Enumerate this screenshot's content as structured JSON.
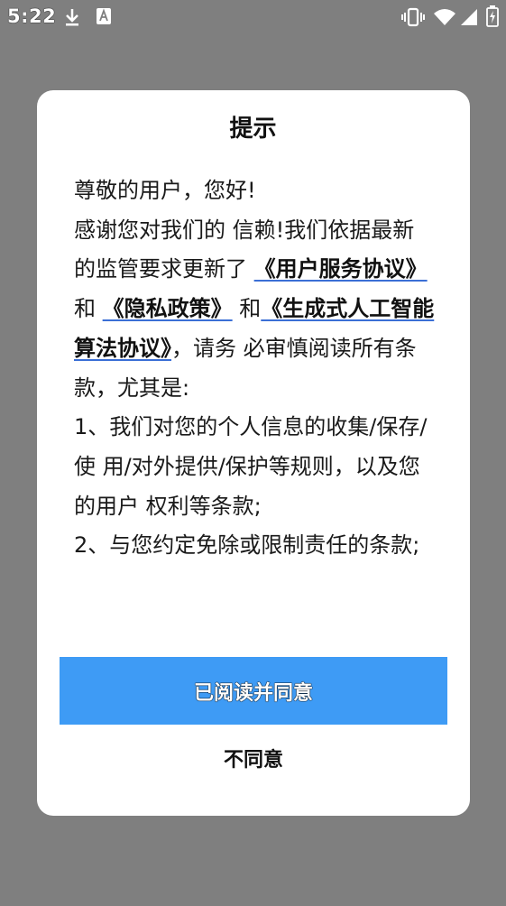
{
  "status_bar": {
    "time": "5:22",
    "icons": [
      "download-icon",
      "a-notification-icon",
      "vibrate-icon",
      "wifi-icon",
      "signal-icon",
      "battery-charging-icon"
    ]
  },
  "dialog": {
    "title": "提示",
    "greeting": "尊敬的用户，您好!",
    "body_part1": "感谢您对我们的 信赖!我们依据最新的监管要求更新了 ",
    "link_user_agreement": "《用户服务协议》",
    "connector1": " 和 ",
    "link_privacy_policy": "《隐私政策》",
    "connector2": " 和",
    "link_algorithm_agreement": "《生成式人工智能算法协议》",
    "body_part2": "，请务 必审慎阅读所有条款，尤其是:",
    "clause1": " 1、我们对您的个人信息的收集/保存/使 用/对外提供/保护等规则，以及您的用户 权利等条款;",
    "clause2": " 2、与您约定免除或限制责任的条款;",
    "agree_label": "已阅读并同意",
    "disagree_label": "不同意"
  },
  "colors": {
    "overlay": "#7f7f7f",
    "primary_button": "#3e9bf5",
    "link_underline": "#3b6fd6"
  }
}
